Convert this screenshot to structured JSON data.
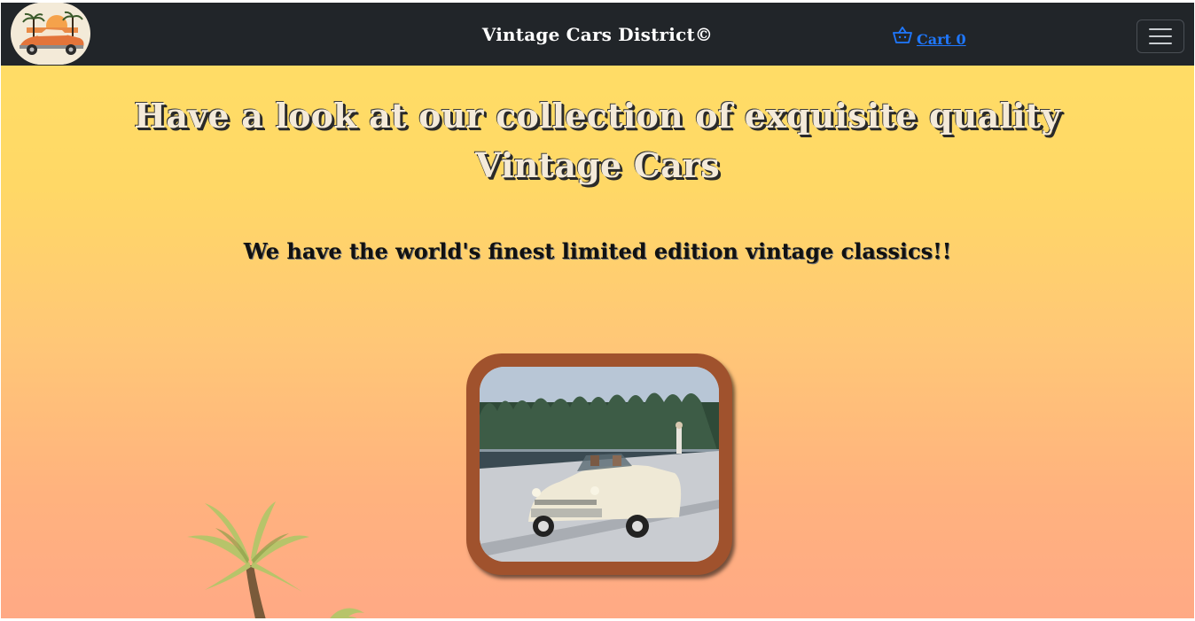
{
  "navbar": {
    "brand": "Vintage Cars District©",
    "cart_label": "Cart 0",
    "logo_icon": "vintage-car-logo",
    "cart_icon": "basket-icon",
    "menu_icon": "hamburger-menu-icon"
  },
  "hero": {
    "headline": "Have a look at our collection of exquisite quality Vintage Cars",
    "subline": "We have the world's finest limited edition vintage classics!!"
  },
  "colors": {
    "navbar_bg": "#212529",
    "cart_link": "#1f78ff",
    "gradient_top": "#ffdf66",
    "gradient_bottom": "#ffa985",
    "frame": "#a0522d"
  }
}
